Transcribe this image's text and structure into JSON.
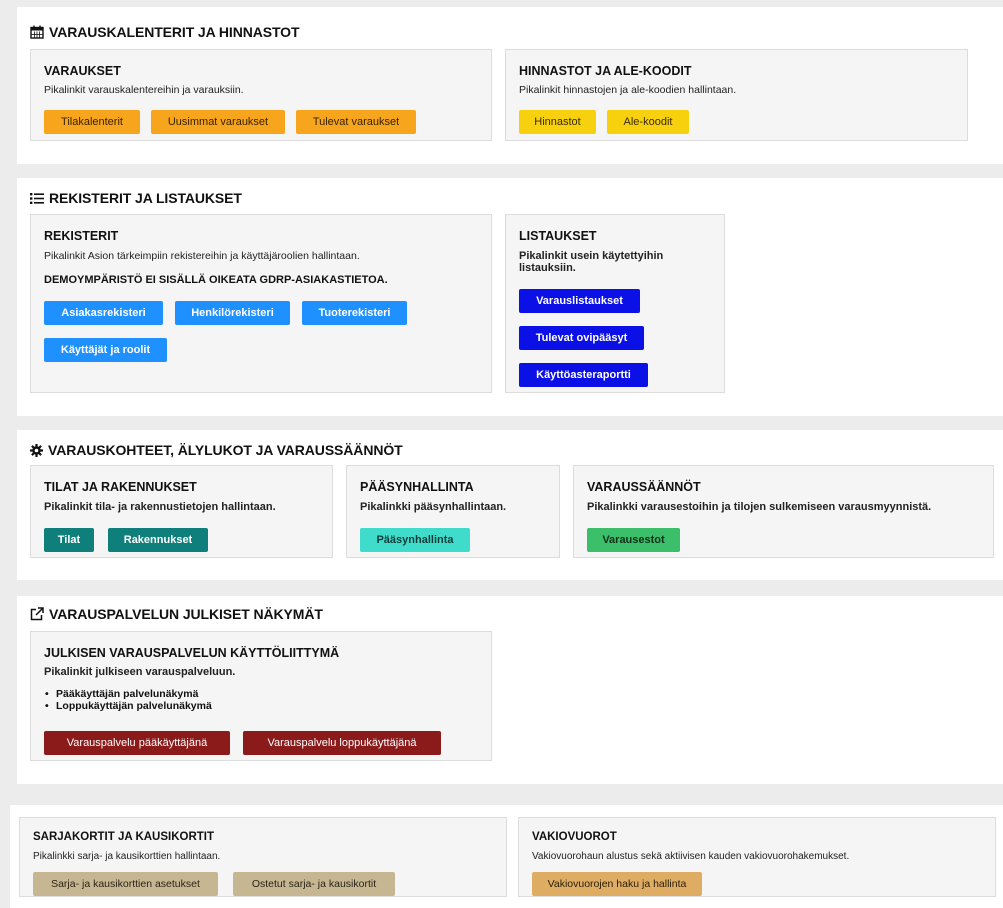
{
  "sections": {
    "reservations": {
      "title": "VARAUSKALENTERIT JA HINNASTOT",
      "icon": "calendar-icon",
      "cards": {
        "varaukset": {
          "title": "VARAUKSET",
          "desc": "Pikalinkit varauskalentereihin ja varauksiin.",
          "buttons": [
            "Tilakalenterit",
            "Uusimmat varaukset",
            "Tulevat varaukset"
          ]
        },
        "hinnastot": {
          "title": "HINNASTOT JA ALE-KOODIT",
          "desc": "Pikalinkit hinnastojen ja ale-koodien hallintaan.",
          "buttons": [
            "Hinnastot",
            "Ale-koodit"
          ]
        }
      }
    },
    "registers": {
      "title": "REKISTERIT JA LISTAUKSET",
      "icon": "list-icon",
      "cards": {
        "rekisterit": {
          "title": "REKISTERIT",
          "desc": "Pikalinkit Asion tärkeimpiin rekistereihin ja käyttäjäroolien hallintaan.",
          "warning": "DEMOYMPÄRISTÖ EI SISÄLLÄ OIKEATA GDRP-ASIAKASTIETOA.",
          "buttons": [
            "Asiakasrekisteri",
            "Henkilörekisteri",
            "Tuoterekisteri",
            "Käyttäjät ja roolit"
          ]
        },
        "listaukset": {
          "title": "LISTAUKSET",
          "desc_line1": "Pikalinkit usein käytettyihin",
          "desc_line2": "listauksiin.",
          "buttons": [
            "Varauslistaukset",
            "Tulevat ovipääsyt",
            "Käyttöasteraportti"
          ]
        }
      }
    },
    "targets": {
      "title": "VARAUSKOHTEET, ÄLYLUKOT JA VARAUSSÄÄNNÖT",
      "icon": "gear-icon",
      "cards": {
        "tilat": {
          "title": "TILAT JA RAKENNUKSET",
          "desc": "Pikalinkit tila- ja rakennustietojen hallintaan.",
          "buttons": [
            "Tilat",
            "Rakennukset"
          ]
        },
        "paasy": {
          "title": "PÄÄSYNHALLINTA",
          "desc": "Pikalinkki pääsynhallintaan.",
          "buttons": [
            "Pääsynhallinta"
          ]
        },
        "saannot": {
          "title": "VARAUSSÄÄNNÖT",
          "desc": "Pikalinkki varausestoihin ja tilojen sulkemiseen varausmyynnistä.",
          "buttons": [
            "Varausestot"
          ]
        }
      }
    },
    "public": {
      "title": "VARAUSPALVELUN JULKISET NÄKYMÄT",
      "icon": "external-link-icon",
      "cards": {
        "julkinen": {
          "title": "JULKISEN VARAUSPALVELUN KÄYTTÖLIITTYMÄ",
          "desc": "Pikalinkit julkiseen varauspalveluun.",
          "bullets": [
            "Pääkäyttäjän palvelunäkymä",
            "Loppukäyttäjän palvelunäkymä"
          ],
          "buttons": [
            "Varauspalvelu pääkäyttäjänä",
            "Varauspalvelu loppukäyttäjänä"
          ]
        }
      }
    },
    "extra": {
      "cards": {
        "sarjakortit": {
          "title": "SARJAKORTIT JA KAUSIKORTIT",
          "desc": "Pikalinkki sarja- ja kausikorttien hallintaan.",
          "buttons": [
            "Sarja- ja kausikorttien asetukset",
            "Ostetut sarja- ja kausikortit"
          ]
        },
        "vakiovuorot": {
          "title": "VAKIOVUOROT",
          "desc": "Vakiovuorohaun alustus sekä aktiivisen kauden vakiovuorohakemukset.",
          "buttons": [
            "Vakiovuorojen haku ja hallinta"
          ]
        }
      }
    }
  }
}
